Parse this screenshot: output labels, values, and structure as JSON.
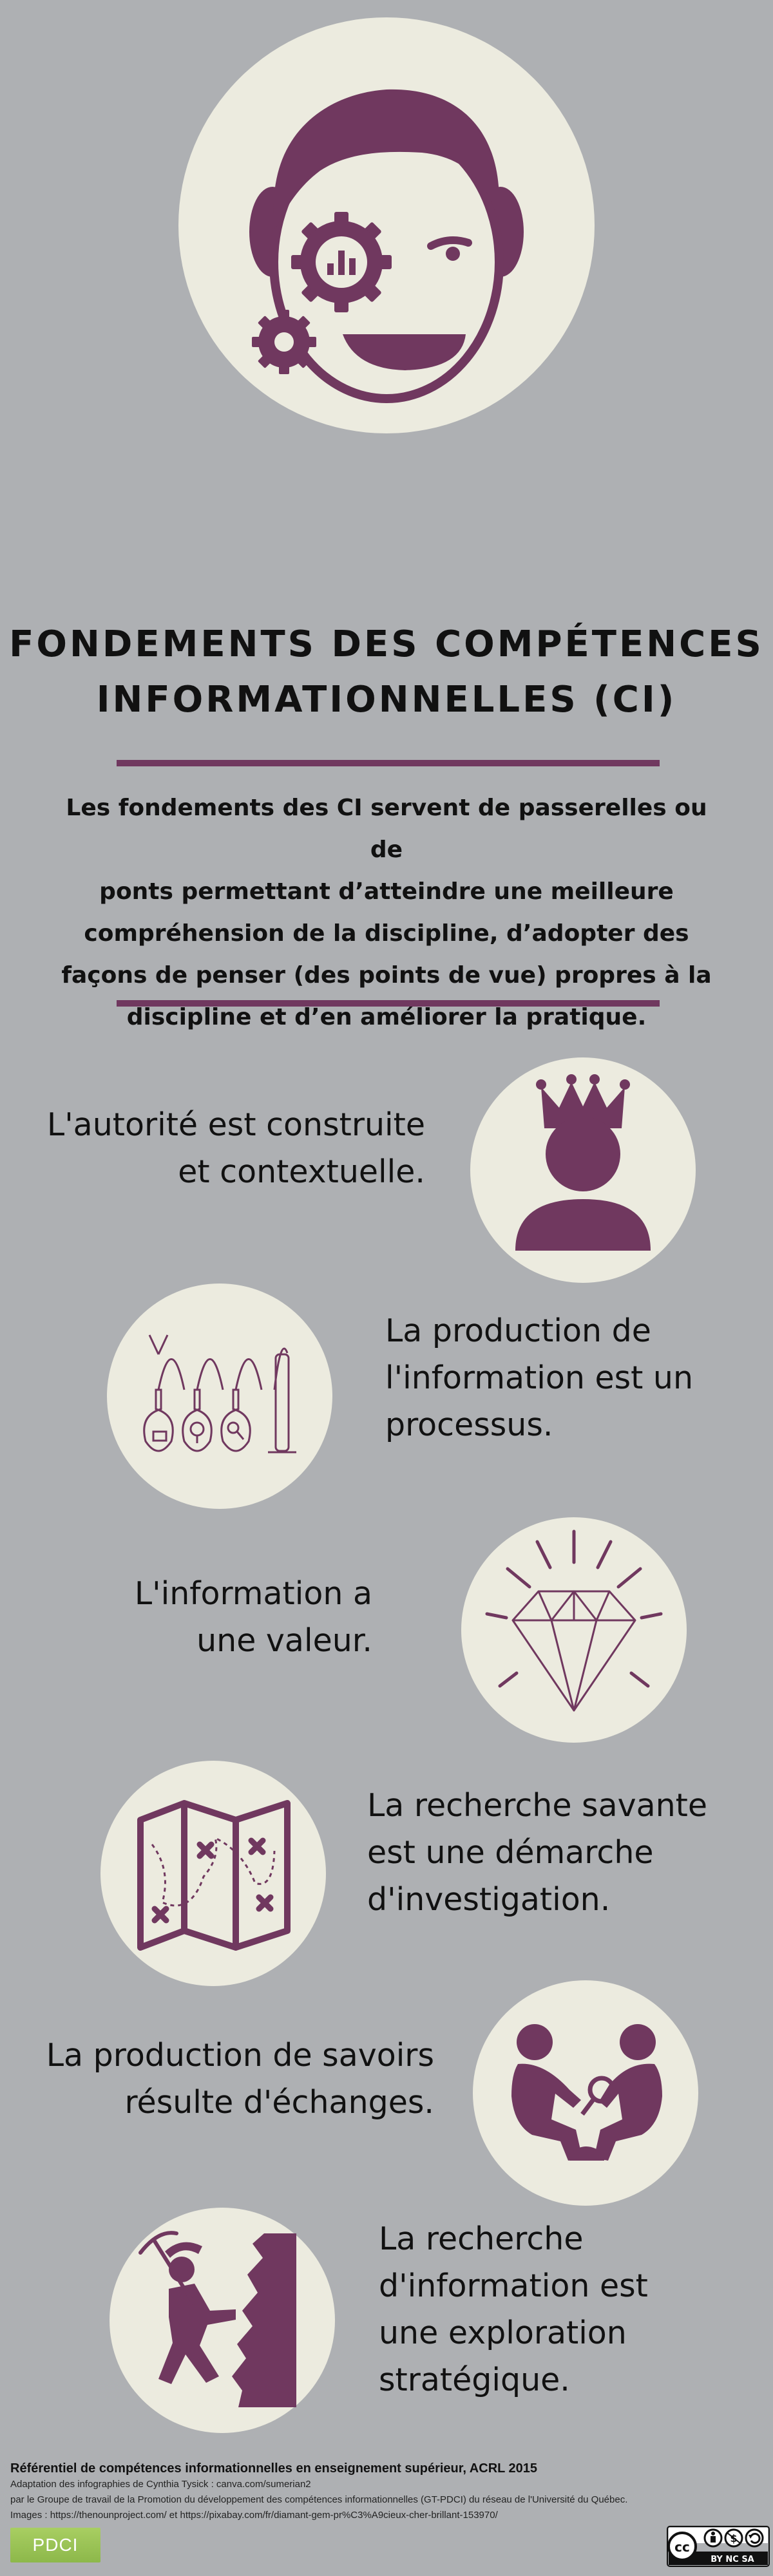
{
  "header": {
    "title_line1": "FONDEMENTS DES COMPÉTENCES",
    "title_line2": "INFORMATIONNELLES (CI)",
    "intro_line1": "Les fondements des CI servent de passerelles ou de",
    "intro_line2": "ponts permettant d’atteindre une meilleure",
    "intro_line3": "compréhension de la discipline, d’adopter des",
    "intro_line4": "façons de penser (des points de vue) propres à la",
    "intro_line5": "discipline et d’en améliorer la pratique.",
    "hero_icon": "head-with-gears-icon"
  },
  "frames": [
    {
      "line1": "L'autorité est construite",
      "line2": "et contextuelle.",
      "icon": "crowned-person-icon"
    },
    {
      "line1": "La production de",
      "line2": "l'information est un",
      "line3": "processus.",
      "icon": "test-tubes-icon"
    },
    {
      "line1": "L'information a",
      "line2": "une valeur.",
      "icon": "diamond-icon"
    },
    {
      "line1": "La recherche savante",
      "line2": "est une démarche",
      "line3": "d'investigation.",
      "icon": "treasure-map-icon"
    },
    {
      "line1": "La production de savoirs",
      "line2": "résulte d'échanges.",
      "icon": "two-people-digging-icon"
    },
    {
      "line1": "La recherche",
      "line2": "d'information est",
      "line3": "une exploration",
      "line4": "stratégique.",
      "icon": "miner-climbing-icon"
    }
  ],
  "footer": {
    "title": "Référentiel de compétences informationnelles en enseignement supérieur, ACRL 2015",
    "line1": "Adaptation des infographies de Cynthia Tysick : canva.com/sumerian2",
    "line2": "par le Groupe de travail de la Promotion du développement des compétences informationnelles (GT-PDCI) du réseau de l'Université du Québec.",
    "line3": "Images : https://thenounproject.com/ et https://pixabay.com/fr/diamant-gem-pr%C3%A9cieux-cher-brillant-153970/",
    "logo_text": "PDCI",
    "license_label": "BY NC SA"
  },
  "colors": {
    "background": "#aeb0b3",
    "circle": "#ecebdf",
    "accent": "#70385f",
    "text": "#111111"
  }
}
